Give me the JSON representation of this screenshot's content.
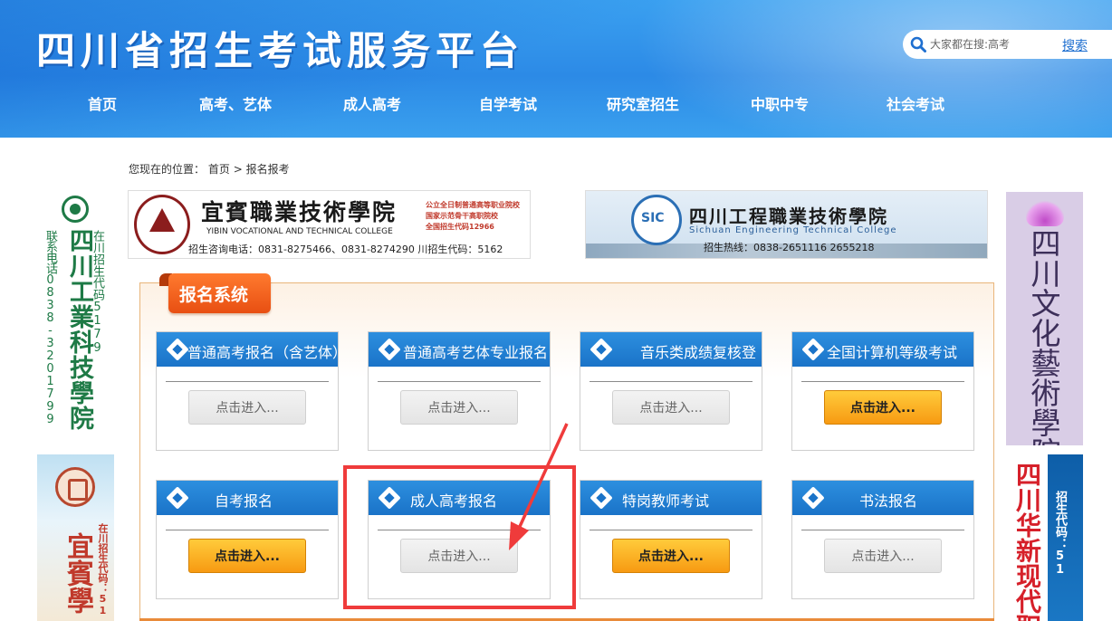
{
  "header": {
    "site_title": "四川省招生考试服务平台",
    "search_placeholder": "大家都在搜:高考",
    "search_button": "搜索",
    "nav": [
      "首页",
      "高考、艺体",
      "成人高考",
      "自学考试",
      "研究室招生",
      "中职中专",
      "社会考试"
    ]
  },
  "breadcrumb": {
    "prefix": "您现在的位置：",
    "home": "首页",
    "sep": ">",
    "current": "报名报考"
  },
  "banners": {
    "yibin": {
      "name": "宜賓職業技術學院",
      "en": "YIBIN VOCATIONAL AND TECHNICAL COLLEGE",
      "tags": [
        "公立全日制普通高等职业院校",
        "国家示范骨干高职院校",
        "全国招生代码12966"
      ],
      "phone": "招生咨询电话：0831-8275466、0831-8274290  川招生代码：5162"
    },
    "sichuan": {
      "name": "四川工程職業技術學院",
      "en": "Sichuan Engineering Technical College",
      "phone": "招生热线：0838-2651116   2655218"
    }
  },
  "side_ads": {
    "left_top": {
      "name": "四川工業科技學院",
      "phone": "联系电话0838-3201799",
      "code": "在川招生代码5179"
    },
    "left_bottom": {
      "name": "宜賓學",
      "code": "在川招生代码：51"
    },
    "right_top": {
      "name": "四川文化藝術學院"
    },
    "right_bottom": {
      "name": "四川华新现代职",
      "code": "招生代码：51"
    }
  },
  "panel": {
    "title": "报名系统",
    "cards": [
      {
        "title": "普通高考报名（含艺体）",
        "button": "点击进入...",
        "state": "disabled"
      },
      {
        "title": "普通高考艺体专业报名",
        "button": "点击进入...",
        "state": "disabled"
      },
      {
        "title": "音乐类成绩复核登",
        "button": "点击进入...",
        "state": "disabled"
      },
      {
        "title": "全国计算机等级考试",
        "button": "点击进入...",
        "state": "active"
      },
      {
        "title": "自考报名",
        "button": "点击进入...",
        "state": "active"
      },
      {
        "title": "成人高考报名",
        "button": "点击进入...",
        "state": "disabled"
      },
      {
        "title": "特岗教师考试",
        "button": "点击进入...",
        "state": "active"
      },
      {
        "title": "书法报名",
        "button": "点击进入...",
        "state": "disabled"
      }
    ]
  },
  "colors": {
    "header_blue": "#2c8ae6",
    "card_head_blue": "#1a73c8",
    "tab_orange": "#e84f12",
    "active_button": "#f79a12",
    "highlight_red": "#ef3b3b"
  }
}
